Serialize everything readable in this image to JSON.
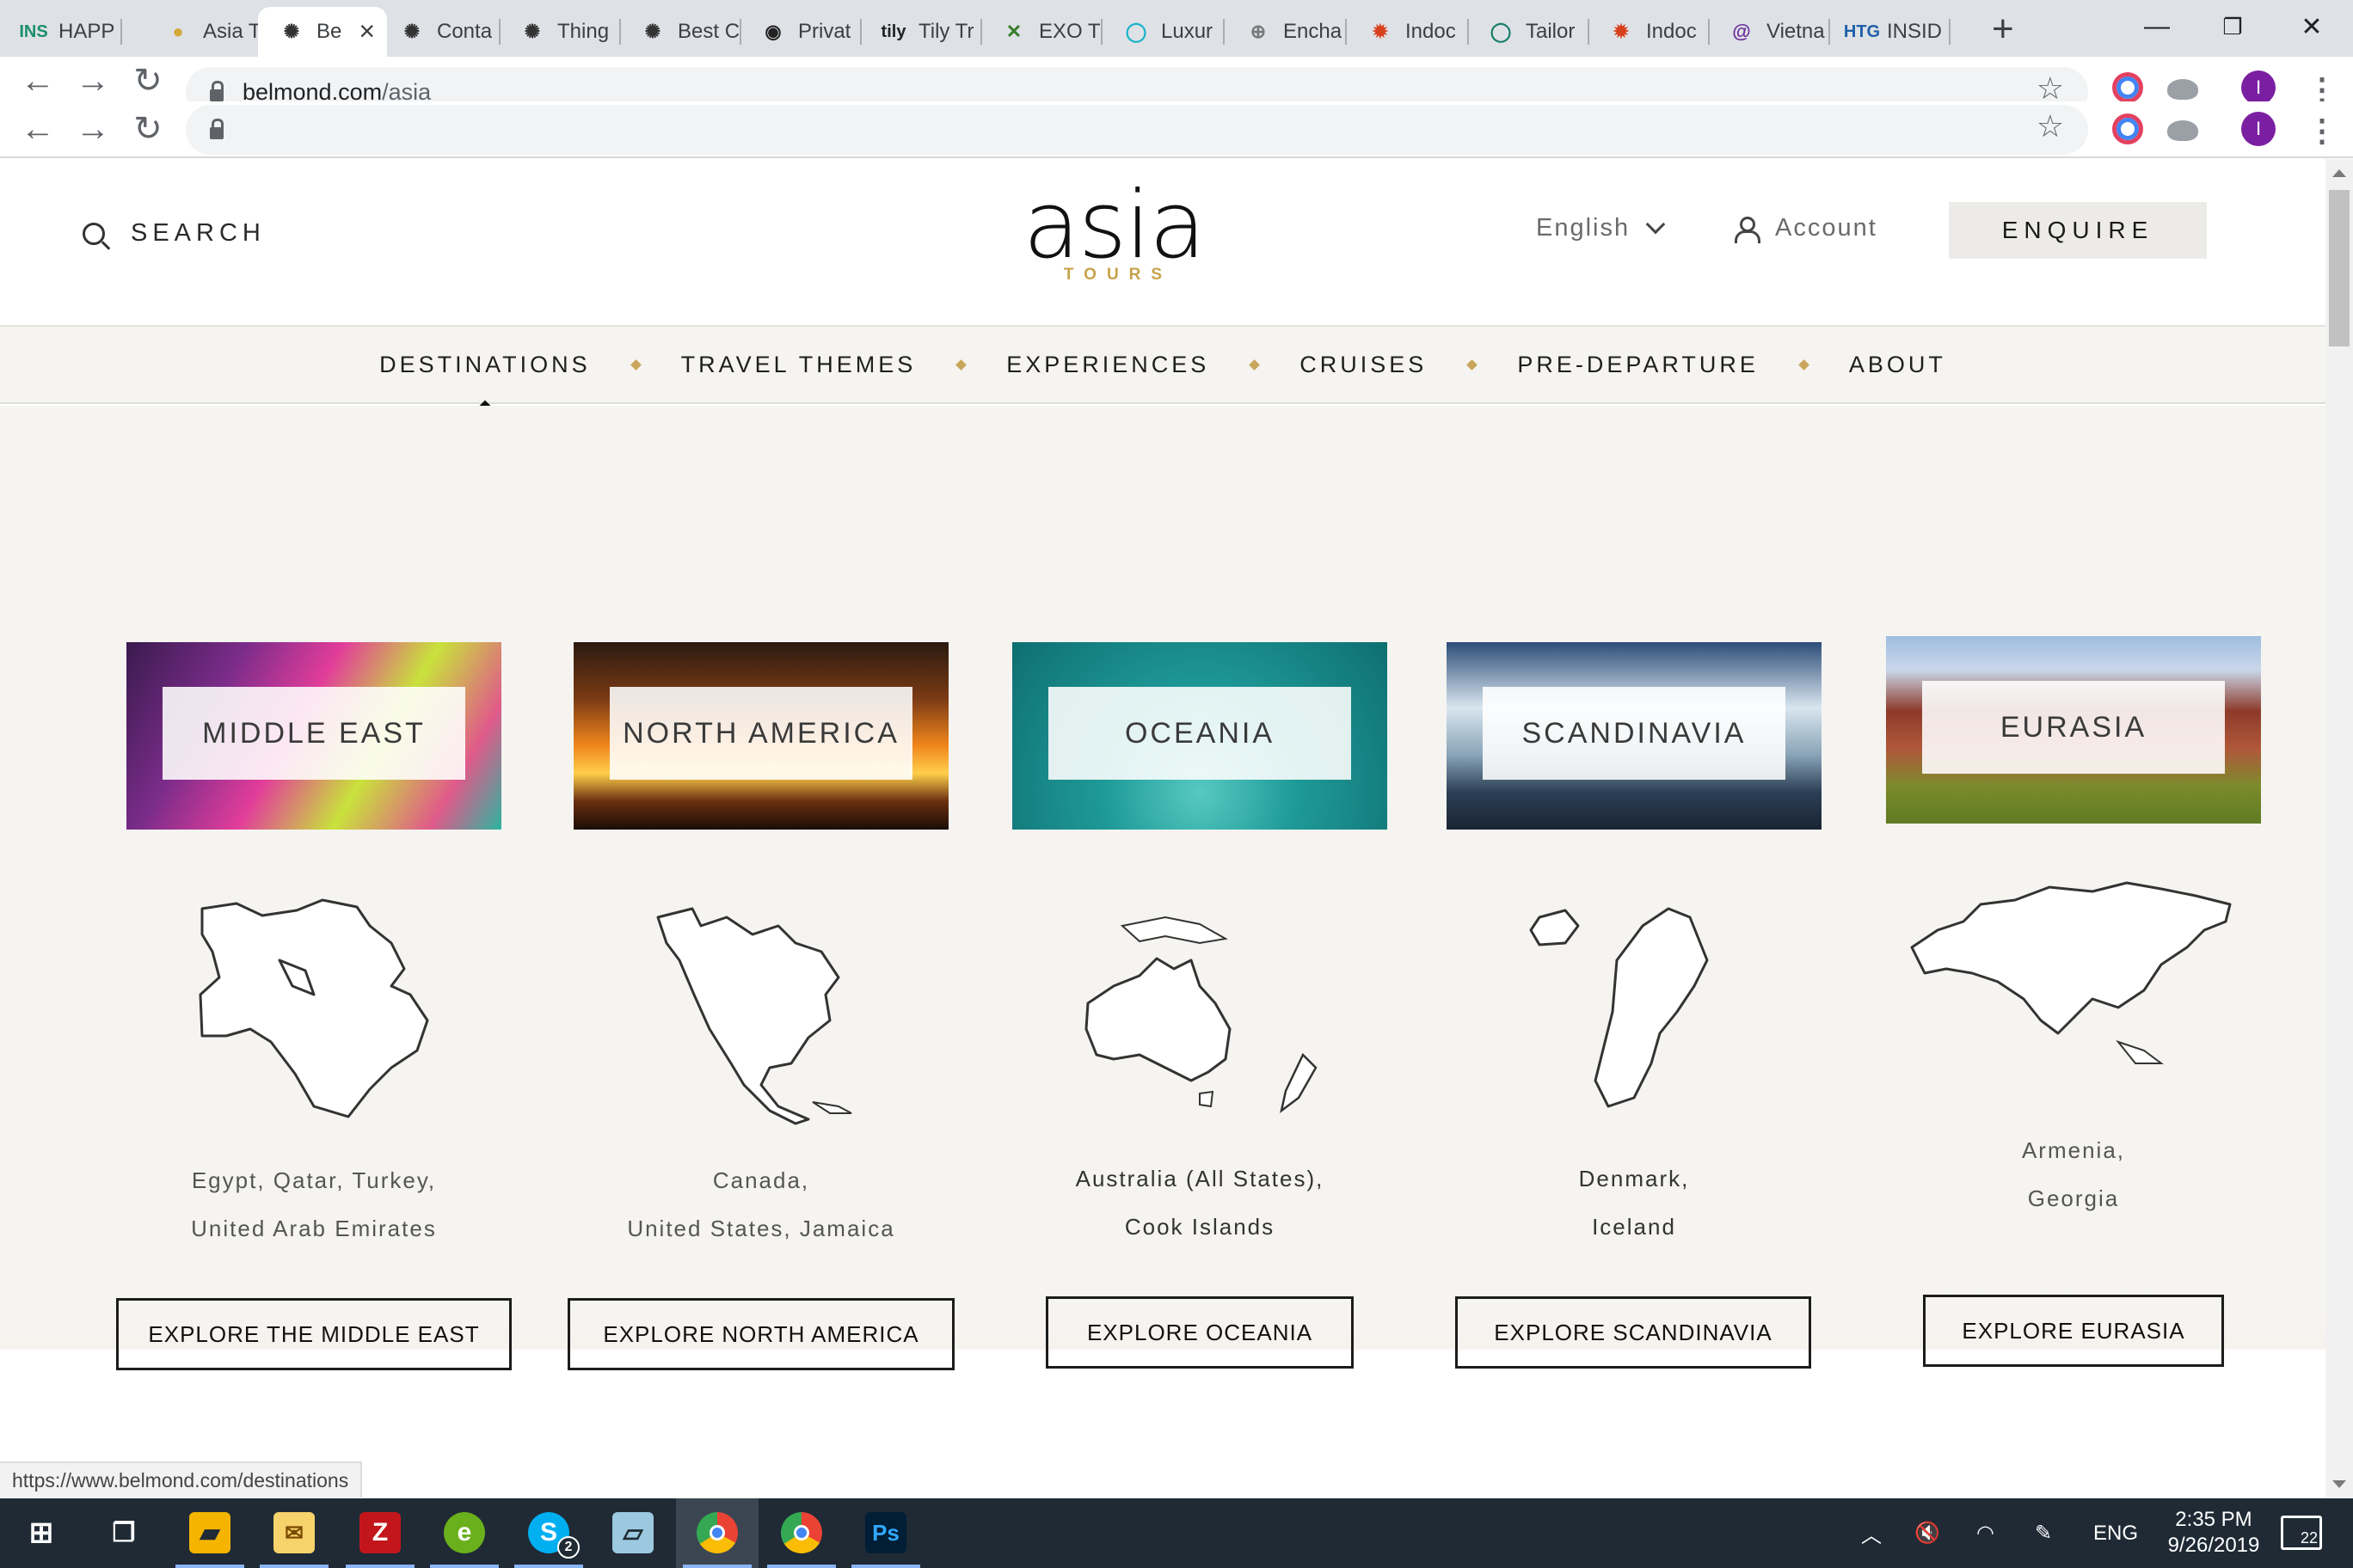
{
  "browser": {
    "tabs": [
      {
        "favicon": "INS",
        "title": "HAPP",
        "favicon_color": "#1a8f6a"
      },
      {
        "favicon": "●",
        "title": "Asia T",
        "favicon_color": "#d4a93a"
      },
      {
        "favicon": "✺",
        "title": "Be",
        "favicon_color": "#333333",
        "active": true
      },
      {
        "favicon": "✺",
        "title": "Conta",
        "favicon_color": "#333333"
      },
      {
        "favicon": "✺",
        "title": "Thing",
        "favicon_color": "#333333"
      },
      {
        "favicon": "✺",
        "title": "Best C",
        "favicon_color": "#333333"
      },
      {
        "favicon": "◉",
        "title": "Privat",
        "favicon_color": "#222222"
      },
      {
        "favicon": "tily",
        "title": "Tily Tr",
        "favicon_color": "#222222"
      },
      {
        "favicon": "✕",
        "title": "EXO T",
        "favicon_color": "#3a7d2c"
      },
      {
        "favicon": "◯",
        "title": "Luxur",
        "favicon_color": "#1ab3c9"
      },
      {
        "favicon": "⊕",
        "title": "Encha",
        "favicon_color": "#777777"
      },
      {
        "favicon": "✹",
        "title": "Indoc",
        "favicon_color": "#d8401c"
      },
      {
        "favicon": "◯",
        "title": "Tailor",
        "favicon_color": "#1a7f6b"
      },
      {
        "favicon": "✹",
        "title": "Indoc",
        "favicon_color": "#d8401c"
      },
      {
        "favicon": "@",
        "title": "Vietna",
        "favicon_color": "#6a2c9a"
      },
      {
        "favicon": "HTG",
        "title": "INSID",
        "favicon_color": "#1f5fa8"
      }
    ],
    "new_tab": "+",
    "window_controls": {
      "minimize": "—",
      "restore": "❐",
      "close": "✕"
    },
    "url_host": "belmond.com",
    "url_path": "/asia",
    "url_second": "",
    "status_url": "https://www.belmond.com/destinations",
    "avatar_letter": "I"
  },
  "header": {
    "search_label": "SEARCH",
    "logo_main": "asia",
    "logo_sub": "TOURS",
    "language": "English",
    "account": "Account",
    "enquire": "ENQUIRE"
  },
  "nav": {
    "items": [
      "DESTINATIONS",
      "TRAVEL THEMES",
      "EXPERIENCES",
      "CRUISES",
      "PRE-DEPARTURE",
      "ABOUT"
    ]
  },
  "destinations": [
    {
      "name": "MIDDLE EAST",
      "countries_line1": "Egypt, Qatar, Turkey,",
      "countries_line2": "United Arab Emirates",
      "cta": "EXPLORE THE MIDDLE EAST"
    },
    {
      "name": "NORTH AMERICA",
      "countries_line1": "Canada,",
      "countries_line2": "United States, Jamaica",
      "cta": "EXPLORE NORTH AMERICA"
    },
    {
      "name": "OCEANIA",
      "countries_line1": "Australia (All States),",
      "countries_line2": "Cook Islands",
      "cta": "EXPLORE OCEANIA"
    },
    {
      "name": "SCANDINAVIA",
      "countries_line1": "Denmark,",
      "countries_line2": "Iceland",
      "cta": "EXPLORE SCANDINAVIA"
    },
    {
      "name": "EURASIA",
      "countries_line1": "Armenia,",
      "countries_line2": "Georgia",
      "cta": "EXPLORE EURASIA"
    }
  ],
  "taskbar": {
    "apps": [
      "windows-start",
      "task-view",
      "file-explorer",
      "mail",
      "filezilla",
      "app-green",
      "skype",
      "notepad",
      "chrome",
      "chrome",
      "photoshop"
    ],
    "skype_badge": "2",
    "language": "ENG",
    "time": "2:35 PM",
    "date": "9/26/2019",
    "notifications": "22"
  },
  "colors": {
    "accent_gold": "#c9a65a",
    "content_bg": "#f5f4f1",
    "taskbar": "#1f2a35"
  }
}
